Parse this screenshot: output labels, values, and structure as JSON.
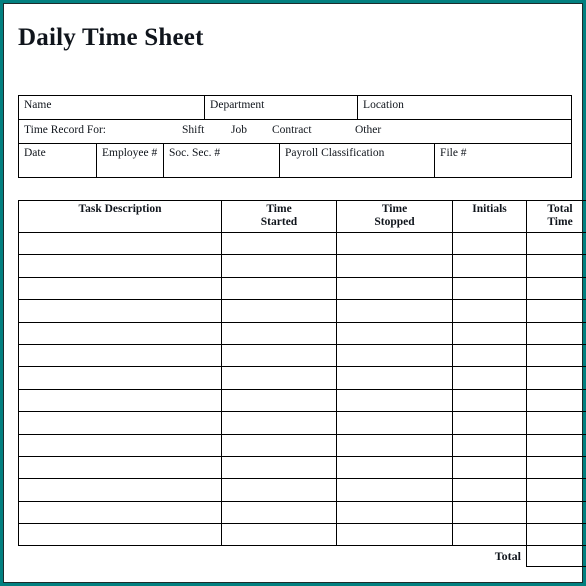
{
  "document": {
    "title": "Daily Time Sheet",
    "accent_color": "#028080",
    "border_color": "#000000",
    "background_color": "#ffffff"
  },
  "info_table": {
    "row1": {
      "name_label": "Name",
      "department_label": "Department",
      "location_label": "Location"
    },
    "row2": {
      "time_record_label": "Time Record For:",
      "options": [
        "Shift",
        "Job",
        "Contract",
        "Other"
      ]
    },
    "row3": {
      "date_label": "Date",
      "employee_label": "Employee #",
      "ssn_label": "Soc. Sec. #",
      "payroll_label": "Payroll Classification",
      "file_label": "File #"
    }
  },
  "task_table": {
    "columns": [
      "Task Description",
      "Time\nStarted",
      "Time\nStopped",
      "Initials",
      "Total\nTime"
    ],
    "column_lines": [
      {
        "line1": "Task Description",
        "line2": ""
      },
      {
        "line1": "Time",
        "line2": "Started"
      },
      {
        "line1": "Time",
        "line2": "Stopped"
      },
      {
        "line1": "Initials",
        "line2": ""
      },
      {
        "line1": "Total",
        "line2": "Time"
      }
    ],
    "row_count": 14,
    "rows": [
      [
        "",
        "",
        "",
        "",
        ""
      ],
      [
        "",
        "",
        "",
        "",
        ""
      ],
      [
        "",
        "",
        "",
        "",
        ""
      ],
      [
        "",
        "",
        "",
        "",
        ""
      ],
      [
        "",
        "",
        "",
        "",
        ""
      ],
      [
        "",
        "",
        "",
        "",
        ""
      ],
      [
        "",
        "",
        "",
        "",
        ""
      ],
      [
        "",
        "",
        "",
        "",
        ""
      ],
      [
        "",
        "",
        "",
        "",
        ""
      ],
      [
        "",
        "",
        "",
        "",
        ""
      ],
      [
        "",
        "",
        "",
        "",
        ""
      ],
      [
        "",
        "",
        "",
        "",
        ""
      ],
      [
        "",
        "",
        "",
        "",
        ""
      ],
      [
        "",
        "",
        "",
        "",
        ""
      ]
    ],
    "total_label": "Total",
    "total_value": ""
  }
}
